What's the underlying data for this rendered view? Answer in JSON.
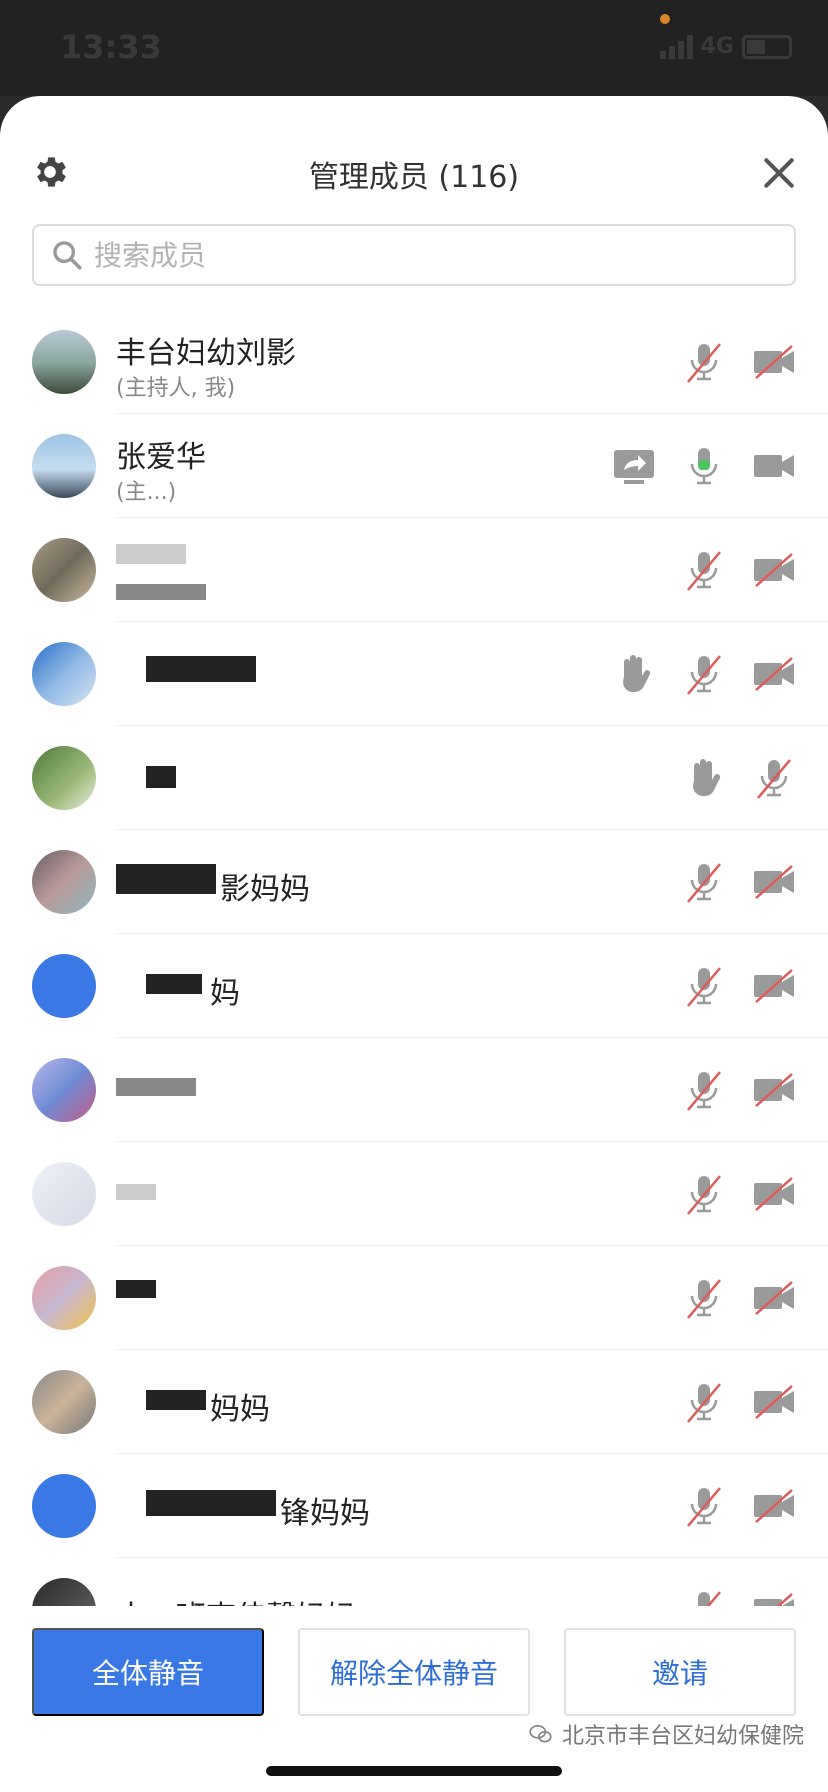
{
  "status": {
    "time": "13:33",
    "network": "4G",
    "battery_level": 0.45
  },
  "header": {
    "title": "管理成员 (116)",
    "settings_icon": "gear-icon",
    "close_icon": "close-icon"
  },
  "search": {
    "placeholder": "搜索成员",
    "value": ""
  },
  "members": [
    {
      "name": "丰台妇幼刘影",
      "role": "(主持人, 我)",
      "icons": [
        "mic-off-icon",
        "camera-off-icon"
      ]
    },
    {
      "name": "张爱华",
      "role": "(主...)",
      "icons": [
        "screen-share-icon",
        "mic-on-icon",
        "camera-on-icon"
      ]
    },
    {
      "name": "",
      "role": "",
      "icons": [
        "mic-off-icon",
        "camera-off-icon"
      ]
    },
    {
      "name": "",
      "role": "",
      "icons": [
        "hand-raise-icon",
        "mic-off-icon",
        "camera-off-icon"
      ]
    },
    {
      "name": "",
      "role": "",
      "icons": [
        "hand-raise-icon",
        "mic-off-icon"
      ]
    },
    {
      "name": "影妈妈",
      "role": "",
      "icons": [
        "mic-off-icon",
        "camera-off-icon"
      ]
    },
    {
      "name": "妈",
      "role": "",
      "icons": [
        "mic-off-icon",
        "camera-off-icon"
      ]
    },
    {
      "name": "",
      "role": "",
      "icons": [
        "mic-off-icon",
        "camera-off-icon"
      ]
    },
    {
      "name": "",
      "role": "",
      "icons": [
        "mic-off-icon",
        "camera-off-icon"
      ]
    },
    {
      "name": "",
      "role": "",
      "icons": [
        "mic-off-icon",
        "camera-off-icon"
      ]
    },
    {
      "name": "妈妈",
      "role": "",
      "icons": [
        "mic-off-icon",
        "camera-off-icon"
      ]
    },
    {
      "name": "锋妈妈",
      "role": "",
      "icons": [
        "mic-off-icon",
        "camera-off-icon"
      ]
    },
    {
      "name": "大二班李佳馨妈妈",
      "role": "",
      "icons": [
        "mic-off-icon",
        "camera-off-icon"
      ]
    }
  ],
  "footer": {
    "mute_all": "全体静音",
    "unmute_all": "解除全体静音",
    "invite": "邀请"
  },
  "watermark": {
    "text": "北京市丰台区妇幼保健院"
  },
  "colors": {
    "primary": "#3a78e6",
    "mute_red": "#e05a5a",
    "mic_on_green": "#4cc45c",
    "icon_gray": "#9a9a9a"
  }
}
